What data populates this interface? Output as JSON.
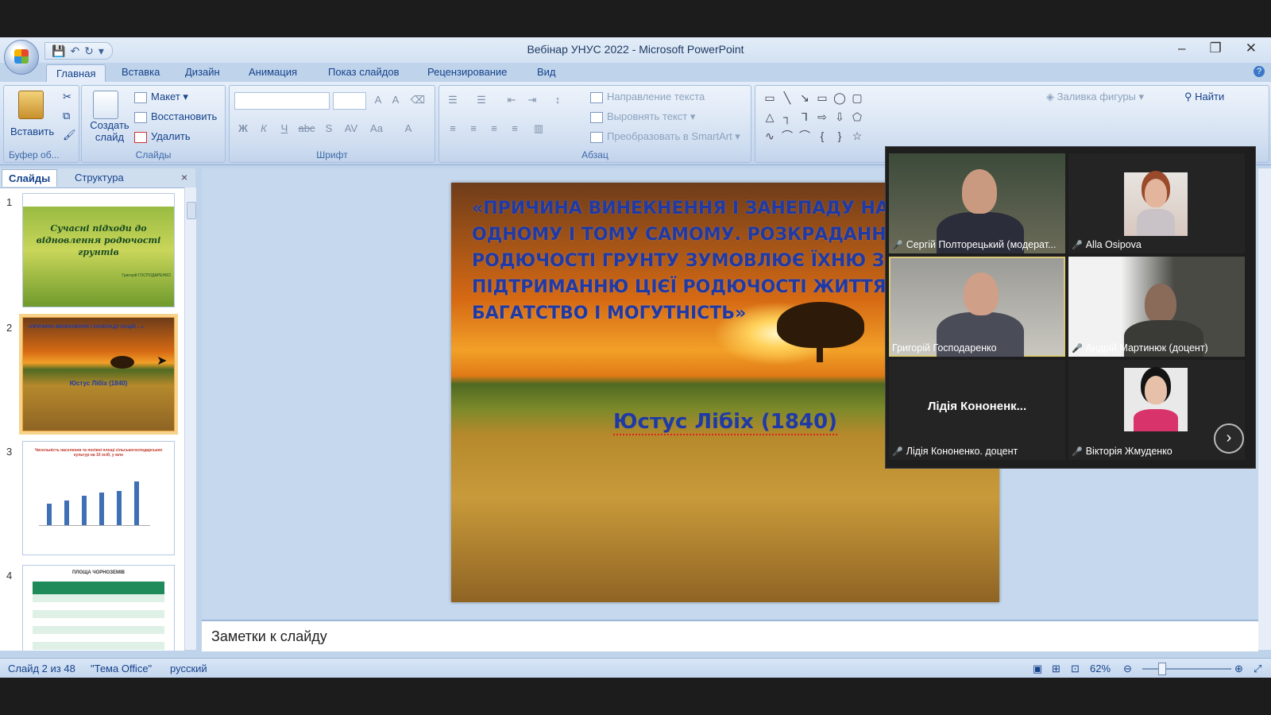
{
  "window": {
    "title": "Вебінар УНУС 2022 - Microsoft PowerPoint",
    "minimize": "–",
    "restore": "❐",
    "close": "✕"
  },
  "qat": {
    "save": "💾",
    "undo": "↶",
    "redo": "↻",
    "more": "▾"
  },
  "tabs": [
    "Главная",
    "Вставка",
    "Дизайн",
    "Анимация",
    "Показ слайдов",
    "Рецензирование",
    "Вид"
  ],
  "ribbon": {
    "clipboard": {
      "paste": "Вставить",
      "label": "Буфер об..."
    },
    "slides": {
      "new_slide": "Создать слайд",
      "layout": "Макет",
      "reset": "Восстановить",
      "delete": "Удалить",
      "label": "Слайды"
    },
    "font": {
      "label": "Шрифт",
      "bold": "Ж",
      "italic": "К",
      "underline": "Ч",
      "strike": "abc",
      "shadow": "S",
      "spacing": "AV",
      "case": "Aa",
      "color": "A"
    },
    "paragraph": {
      "label": "Абзац",
      "text_direction": "Направление текста",
      "align_text": "Выровнять текст",
      "smartart": "Преобразовать в SmartArt"
    },
    "drawing": {
      "fill": "Заливка фигуры",
      "find": "Найти"
    }
  },
  "panel": {
    "tab_slides": "Слайды",
    "tab_outline": "Структура",
    "close": "×",
    "thumbs": [
      {
        "num": "1",
        "title": "Сучасні підходи до відновлення родючості грунтів",
        "author": "Григорій ГОСПОДАРЕНКО"
      },
      {
        "num": "2",
        "text": "«ПРИЧИНА ВИНЕКНЕННЯ І ЗАНЕПАДУ НАЦІЙ ...»",
        "author": "Юстус Лібіх (1840)"
      },
      {
        "num": "3",
        "title": "Чисельність населення та посівні площі сільськогосподарських культур на 10 осіб, у млн"
      },
      {
        "num": "4",
        "title": "ПЛОЩА ЧОРНОЗЕМІВ"
      }
    ]
  },
  "slide": {
    "quote": "«ПРИЧИНА ВИНЕКНЕННЯ І ЗАНЕПАДУ НАЦІЙ В ОДНОМУ І ТОМУ САМОМУ. РОЗКРАДАННЯ РОДЮЧОСТІ ГРУНТУ ЗУМОВЛЮЄ ЇХНЮ ЗАГИБЕЛЬ, ПІДТРИМАННЮ ЦІЄЇ РОДЮЧОСТІ ЖИТТЯ, БАГАТСТВО  І МОГУТНІСТЬ»",
    "author": "Юстус Лібіх (1840)"
  },
  "notes": {
    "placeholder": "Заметки к слайду"
  },
  "status": {
    "slide": "Слайд 2 из 48",
    "theme": "\"Тема Office\"",
    "language": "русский",
    "zoom": "62%"
  },
  "participants": [
    {
      "name": "Сергій Полторецький (модерат...",
      "video": true
    },
    {
      "name": "Alla Osipova",
      "video": true
    },
    {
      "name": "Григорій Господаренко",
      "video": true,
      "active": true
    },
    {
      "name": "Андрій Мартинюк (доцент)",
      "video": true
    },
    {
      "name": "Лідія Кононенко. доцент",
      "placeholder": "Лідія  Кононенк...",
      "video": false
    },
    {
      "name": "Вікторія Жмуденко",
      "video": true
    }
  ],
  "video_next": "›"
}
